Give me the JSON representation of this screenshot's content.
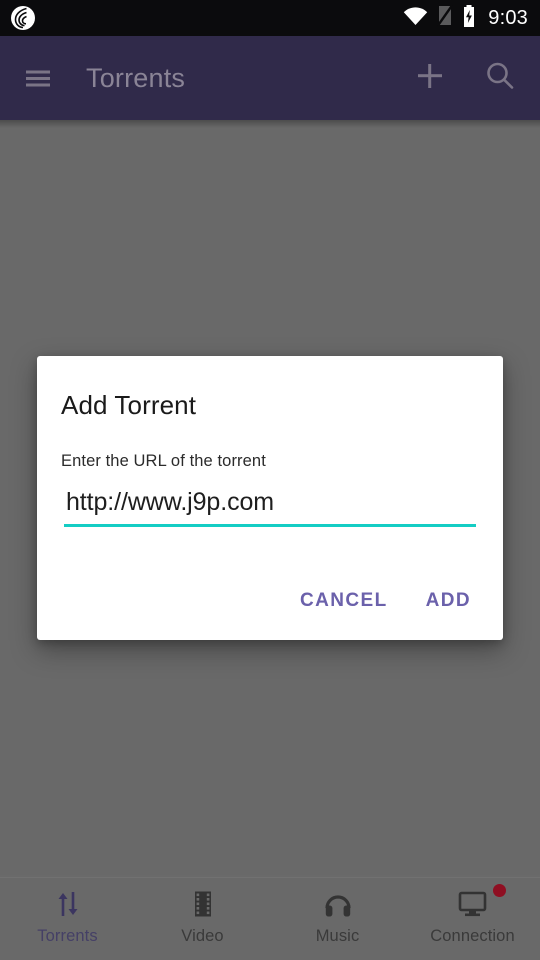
{
  "status_bar": {
    "app_logo_icon": "bittorrent-logo-icon",
    "wifi_icon": "wifi-full-icon",
    "signal_icon": "no-sim-signal-icon",
    "battery_icon": "battery-charging-icon",
    "clock": "9:03"
  },
  "app_bar": {
    "menu_icon": "hamburger-menu-icon",
    "title": "Torrents",
    "add_icon": "plus-icon",
    "search_icon": "search-icon"
  },
  "dialog": {
    "title": "Add Torrent",
    "message": "Enter the URL of the torrent",
    "input": {
      "value": "http://www.j9p.com",
      "placeholder": "http://"
    },
    "cancel_label": "CANCEL",
    "add_label": "ADD"
  },
  "bottom_nav": {
    "items": [
      {
        "label": "Torrents",
        "icon": "transfer-arrows-icon",
        "active": true,
        "badge": false
      },
      {
        "label": "Video",
        "icon": "film-strip-icon",
        "active": false,
        "badge": false
      },
      {
        "label": "Music",
        "icon": "headphones-icon",
        "active": false,
        "badge": false
      },
      {
        "label": "Connection",
        "icon": "monitor-icon",
        "active": false,
        "badge": true
      }
    ]
  },
  "colors": {
    "app_bar": "#302a4a",
    "scrim": "#696969",
    "accent_teal": "#14cdc4",
    "accent_purple": "#6b61ab",
    "badge_red": "#8f0f22",
    "status_bar": "#0b0b0d"
  }
}
